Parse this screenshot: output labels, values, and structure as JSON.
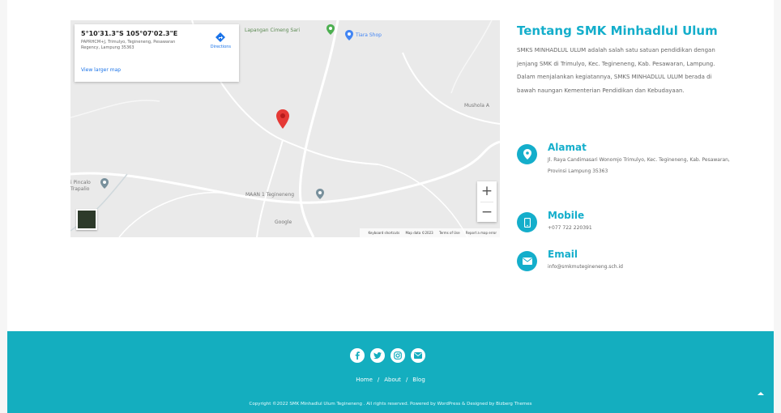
{
  "map": {
    "card": {
      "coordinates": "5°10'31.3\"S 105°07'02.3\"E",
      "address": "PAPRHCM+J, Trimulyo, Tegineneng, Pesawaran Regency, Lampung 35363",
      "larger_map_link": "View larger map",
      "directions_label": "Directions"
    },
    "pois": [
      {
        "label": "Lapangan Cimeng Sari"
      },
      {
        "label": "Tiara Shop"
      },
      {
        "label": "Mushola A"
      },
      {
        "label": "i Pincalo"
      },
      {
        "label": "Trapalio"
      },
      {
        "label": "MAAN 1 Tegineneng"
      }
    ],
    "zoom_in": "+",
    "zoom_out": "−",
    "google_label": "Google",
    "attribution": [
      "Keyboard shortcuts",
      "Map data ©2023",
      "Terms of Use",
      "Report a map error"
    ]
  },
  "about": {
    "title": "Tentang SMK Minhadlul Ulum",
    "description": "SMKS MINHADLUL ULUM adalah salah satu satuan pendidikan dengan jenjang SMK di Trimulyo, Kec. Tegineneng, Kab. Pesawaran, Lampung. Dalam menjalankan kegiatannya, SMKS MINHADLUL ULUM berada di bawah naungan Kementerian Pendidikan dan Kebudayaan."
  },
  "contact": {
    "address": {
      "heading": "Alamat",
      "value": "Jl. Raya Candimasari Wonomjo Trimulyo, Kec. Tegineneng, Kab. Pesawaran, Provinsi Lampung 35363",
      "icon": "map-marker-icon"
    },
    "mobile": {
      "heading": "Mobile",
      "value": "+077 722 220391",
      "icon": "mobile-icon"
    },
    "email": {
      "heading": "Email",
      "value": "info@smkmutegineneng.sch.id",
      "icon": "envelope-icon"
    }
  },
  "footer": {
    "socials": [
      "facebook-icon",
      "twitter-icon",
      "instagram-icon",
      "email-icon"
    ],
    "nav": [
      {
        "label": "Home"
      },
      {
        "label": "About"
      },
      {
        "label": "Blog"
      }
    ],
    "separator": "/",
    "copyright": "Copyright ©2022 SMK Minhadlul Ulum Tegineneng . All rights reserved. Powered by WordPress & Designed by Bizberg Themes",
    "accent_color": "#14aebf"
  },
  "colors": {
    "brand": "#14aecb",
    "pin_red": "#e53935",
    "poi_green": "#5b8a52"
  }
}
